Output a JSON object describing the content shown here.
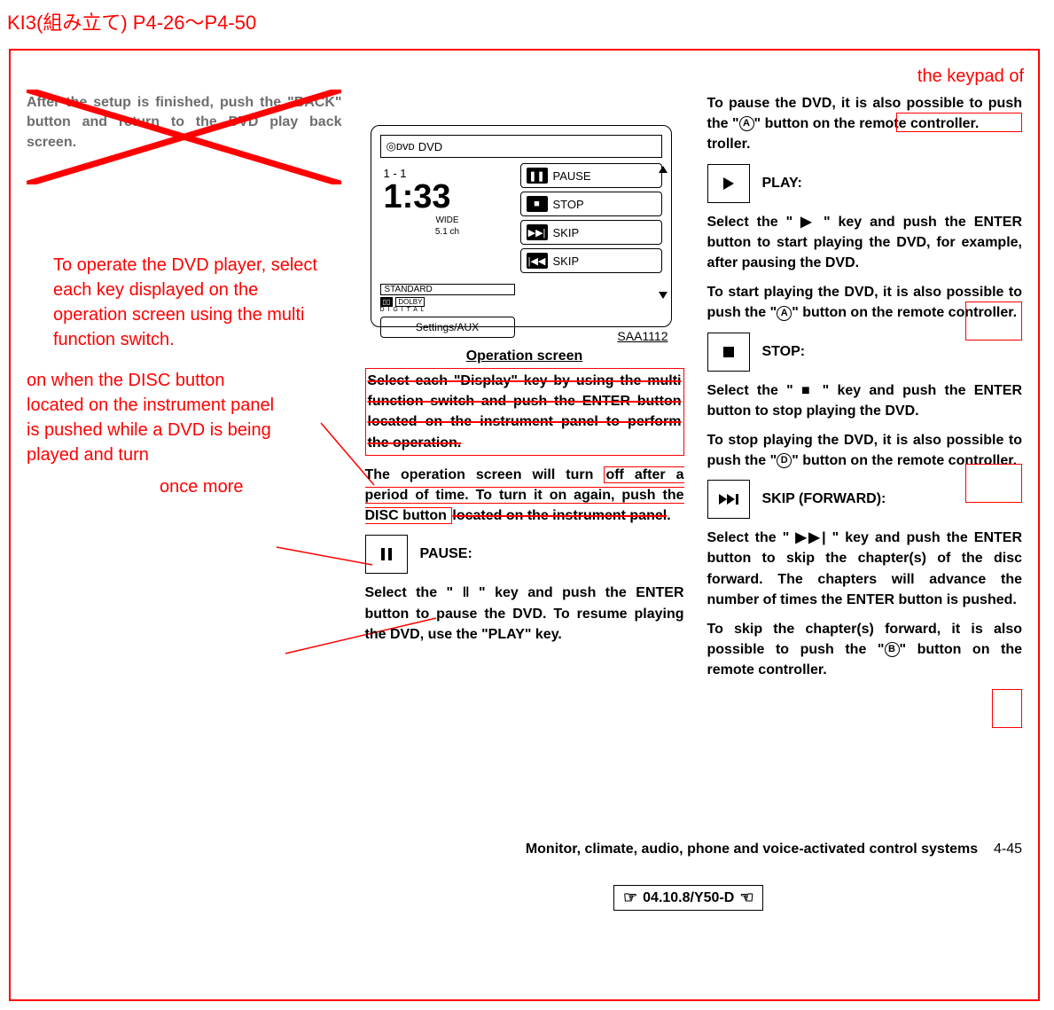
{
  "header_code": "KI3(組み立て) P4-26～P4-50",
  "keypad_note": "the keypad of",
  "col1": {
    "deleted_text": "After the setup is finished, push the \"BACK\" button and return to the DVD play back screen.",
    "note_operate": "To operate the DVD player, select each key displayed on the operation screen using the multi function switch.",
    "note_disc": "on when the DISC button located on the instrument panel is pushed while a DVD is being played and turn",
    "note_once_more": "once more"
  },
  "dvd": {
    "topbar_label": "DVD",
    "track": "1 - 1",
    "time": "1:33",
    "wide": "WIDE",
    "channels": "5.1 ch",
    "standard": "STANDARD",
    "dolby1": "DOLBY",
    "dolby2": "D I G I T A L",
    "settings": "Settings/AUX",
    "keys": {
      "pause": "PAUSE",
      "stop": "STOP",
      "skip1": "SKIP",
      "skip2": "SKIP"
    },
    "code": "SAA1112"
  },
  "col2": {
    "caption": "Operation screen",
    "select_para": "Select each \"Display\" key by using the multi function switch and push the ENTER button located on the instrument panel to perform the operation.",
    "turnoff_para_before": "The operation screen will turn",
    "turnoff_para_after": " off after a period of time. To turn it on again, push the DISC button ",
    "turnoff_strike": "located on the instrument panel",
    "turnoff_end": ".",
    "pause": {
      "label": "PAUSE:",
      "para": "Select the \"  ‖  \" key and push the ENTER button to pause the DVD. To resume playing the DVD, use the \"PLAY\" key."
    }
  },
  "col3": {
    "pause_also_before": "To pause the DVD, it is also possible to push the \"",
    "pause_also_letter": "A",
    "pause_also_after": "\" button on ",
    "pause_also_rc": "the remote controller.",
    "alternate": "troller.",
    "play": {
      "label": "PLAY:",
      "para": "Select the \"  ▶  \" key and push the ENTER button to start playing the DVD, for example, after pausing the DVD.",
      "also_before": "To start playing the DVD, it is also possible to push the \"",
      "also_letter": "A",
      "also_after": "\" button on ",
      "also_rc": "the remote controller."
    },
    "stop": {
      "label": "STOP:",
      "para1": "Select the \"  ■  \" key and push the ENTER button to stop playing the DVD.",
      "also_before": "To stop playing the DVD, it is also possible to push the \"",
      "also_letter": "D",
      "also_after": "\" button on ",
      "also_rc": "the remote controller."
    },
    "skipf": {
      "label": "SKIP (FORWARD):",
      "para": "Select the \"  ▶▶|  \" key and push the ENTER button to skip the chapter(s) of the disc forward. The chapters will advance the number of times the ENTER button is pushed.",
      "also_before": "To skip the chapter(s) forward, it is also possible to push the \"",
      "also_letter": "B",
      "also_after": "\" button on ",
      "also_rc": "the remote controller."
    }
  },
  "footer": {
    "section_title": "Monitor, climate, audio, phone and voice-activated control systems",
    "page": "4-45",
    "date": "04.10.8/Y50-D"
  }
}
